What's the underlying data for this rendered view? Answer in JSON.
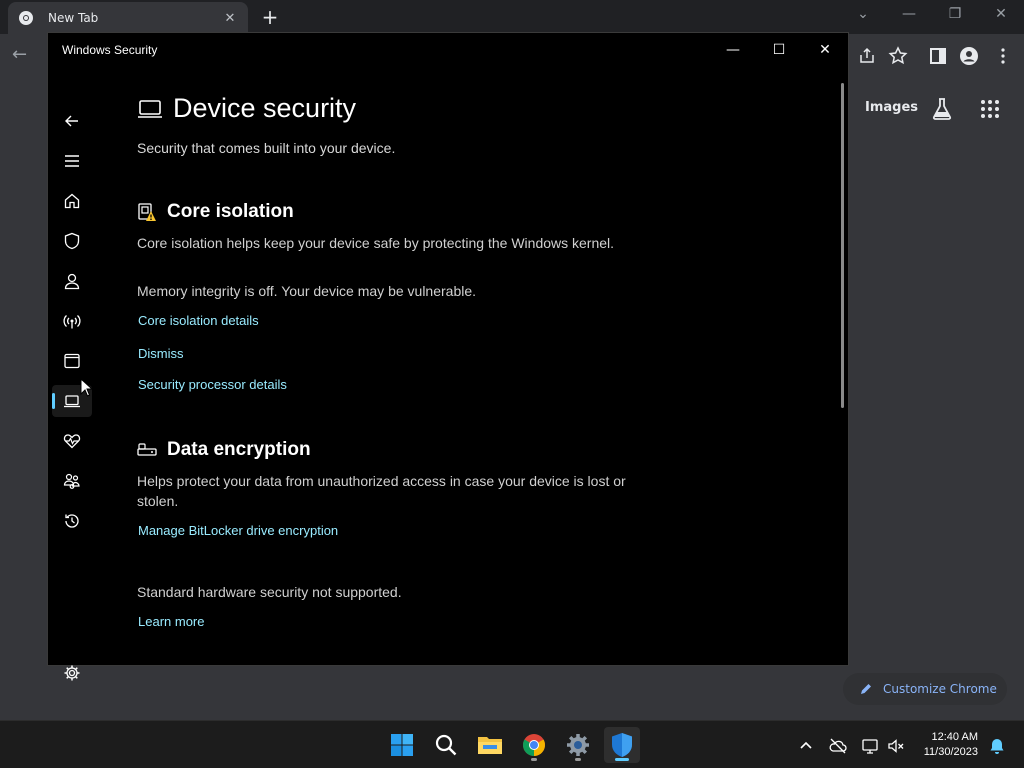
{
  "browser": {
    "tab_title": "New Tab",
    "images_link": "Images",
    "customize_label": "Customize Chrome"
  },
  "window": {
    "title": "Windows Security"
  },
  "page": {
    "title": "Device security",
    "subtitle": "Security that comes built into your device."
  },
  "core_isolation": {
    "heading": "Core isolation",
    "description": "Core isolation helps keep your device safe by protecting the Windows kernel.",
    "status": "Memory integrity is off. Your device may be vulnerable.",
    "details_link": "Core isolation details",
    "dismiss_link": "Dismiss",
    "processor_link": "Security processor details"
  },
  "data_encryption": {
    "heading": "Data encryption",
    "description": "Helps protect your data from unauthorized access in case your device is lost or stolen.",
    "bitlocker_link": "Manage BitLocker drive encryption"
  },
  "hardware": {
    "status": "Standard hardware security not supported.",
    "learn_more": "Learn more"
  },
  "clock": {
    "time": "12:40 AM",
    "date": "11/30/2023"
  },
  "colors": {
    "accent": "#60cdff",
    "link": "#99ebff",
    "warning": "#f8c530"
  }
}
